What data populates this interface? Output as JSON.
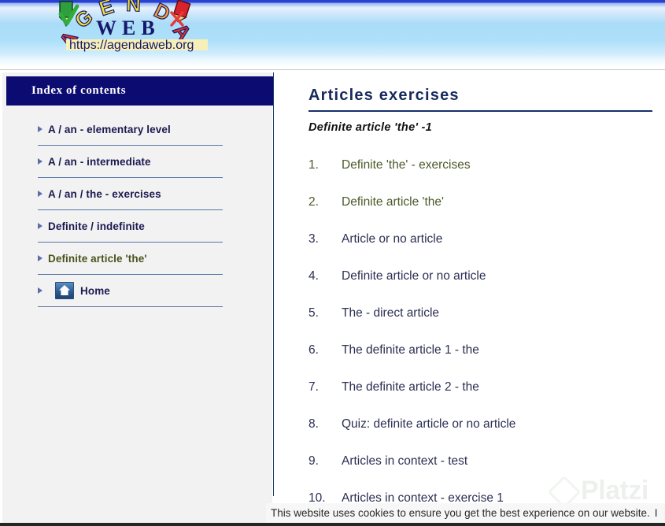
{
  "banner": {
    "logo_word": "AGENDA",
    "logo_sub": "WEB",
    "logo_url": "https://agendaweb.org"
  },
  "sidebar": {
    "title": "Index of contents",
    "items": [
      {
        "label": "A / an - elementary level",
        "icon": "triangle-right-icon",
        "visited": false
      },
      {
        "label": "A / an - intermediate",
        "icon": "triangle-right-icon",
        "visited": false
      },
      {
        "label": "A / an / the - exercises",
        "icon": "triangle-right-icon",
        "visited": false
      },
      {
        "label": "Definite / indefinite",
        "icon": "triangle-right-icon",
        "visited": false
      },
      {
        "label": "Definite article 'the'",
        "icon": "triangle-right-icon",
        "visited": true
      },
      {
        "label": "Home",
        "icon": "home-icon",
        "visited": false
      }
    ]
  },
  "main": {
    "title": "Articles exercises",
    "subtitle": "Definite article 'the' -1",
    "exercises": [
      {
        "num": "1.",
        "label": "Definite 'the' - exercises",
        "visited": true
      },
      {
        "num": "2.",
        "label": "Definite article 'the'",
        "visited": true
      },
      {
        "num": "3.",
        "label": "Article or no article",
        "visited": false
      },
      {
        "num": "4.",
        "label": "Definite article or no article",
        "visited": false
      },
      {
        "num": "5.",
        "label": "The - direct article",
        "visited": false
      },
      {
        "num": "6.",
        "label": "The definite article 1 - the",
        "visited": false
      },
      {
        "num": "7.",
        "label": "The definite article 2 - the",
        "visited": false
      },
      {
        "num": "8.",
        "label": "Quiz: definite article or no article",
        "visited": false
      },
      {
        "num": "9.",
        "label": "Articles in context - test",
        "visited": false
      },
      {
        "num": "10.",
        "label": "Articles in context - exercise 1",
        "visited": false
      }
    ]
  },
  "watermark": {
    "text": "Platzi"
  },
  "cookie": {
    "message": "This website uses cookies to ensure you get the best experience on our website.",
    "button": "I"
  },
  "colors": {
    "sidebar_header_bg": "#0b0b72",
    "divider": "#1c3c66",
    "title": "#162a5c",
    "visited_link": "#4b5a29",
    "link": "#2b2f52",
    "sidebar_bg": "#f2f2f2"
  }
}
